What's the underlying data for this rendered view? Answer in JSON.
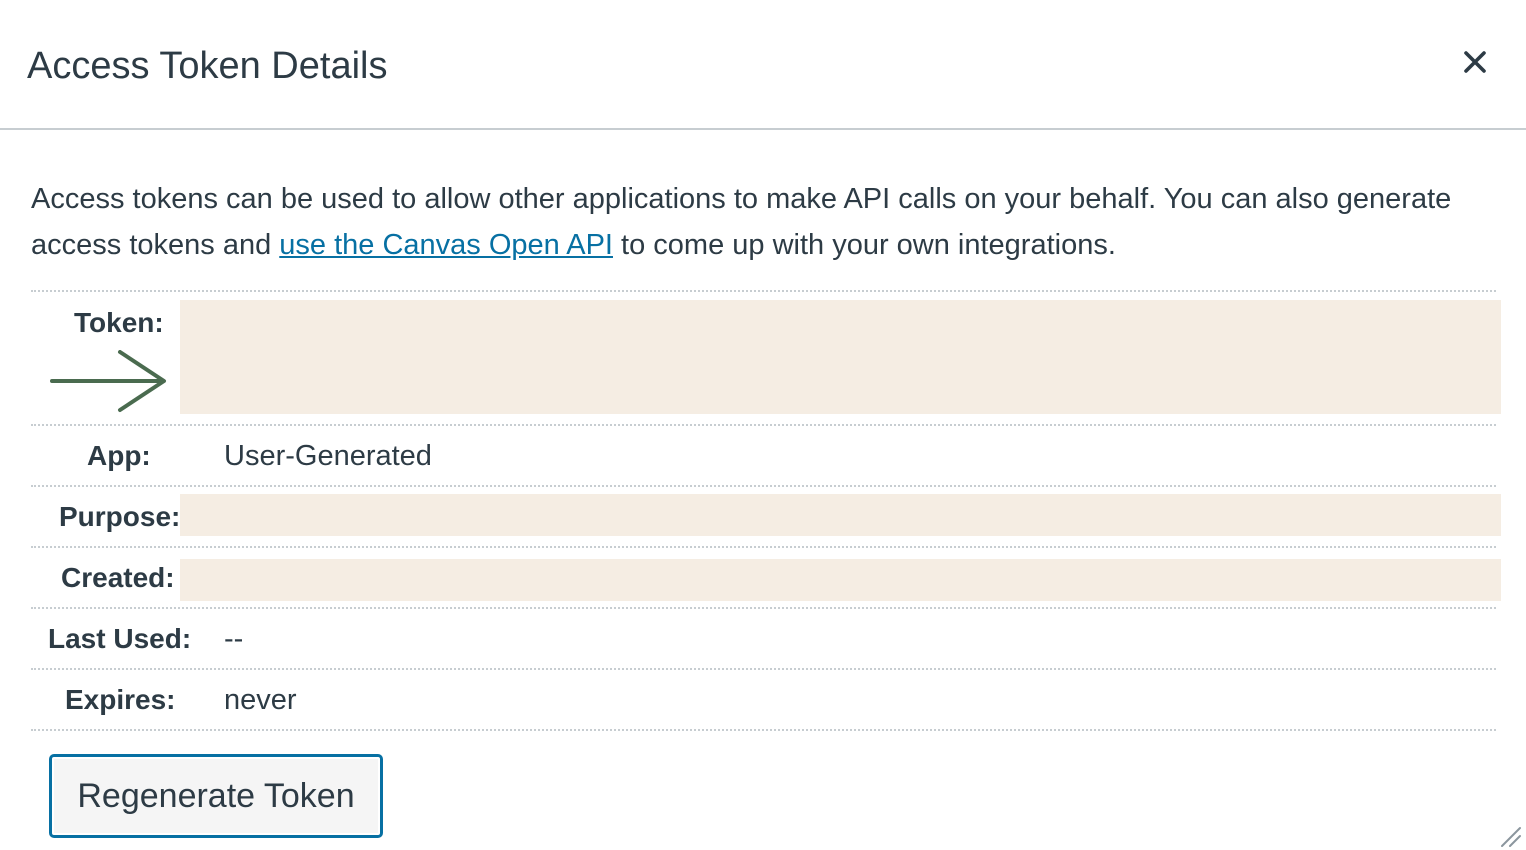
{
  "dialog": {
    "title": "Access Token Details",
    "close_icon": "close-icon",
    "intro": {
      "text_before": "Access tokens can be used to allow other applications to make API calls on your behalf. You can also generate access tokens and ",
      "link_text": "use the Canvas Open API",
      "text_after": " to come up with your own integrations."
    },
    "rows": {
      "token": {
        "label": "Token:",
        "value": ""
      },
      "app": {
        "label": "App:",
        "value": "User-Generated"
      },
      "purpose": {
        "label": "Purpose:",
        "value": ""
      },
      "created": {
        "label": "Created:",
        "value": ""
      },
      "last_used": {
        "label": "Last Used:",
        "value": "--"
      },
      "expires": {
        "label": "Expires:",
        "value": "never"
      }
    },
    "regenerate_label": "Regenerate Token",
    "annotation_arrow": "arrow-right-icon",
    "colors": {
      "link": "#0770a3",
      "text": "#2d3b45",
      "redaction": "#f5ede3",
      "arrow": "#4a6b4f",
      "button_border": "#0770a3"
    }
  }
}
